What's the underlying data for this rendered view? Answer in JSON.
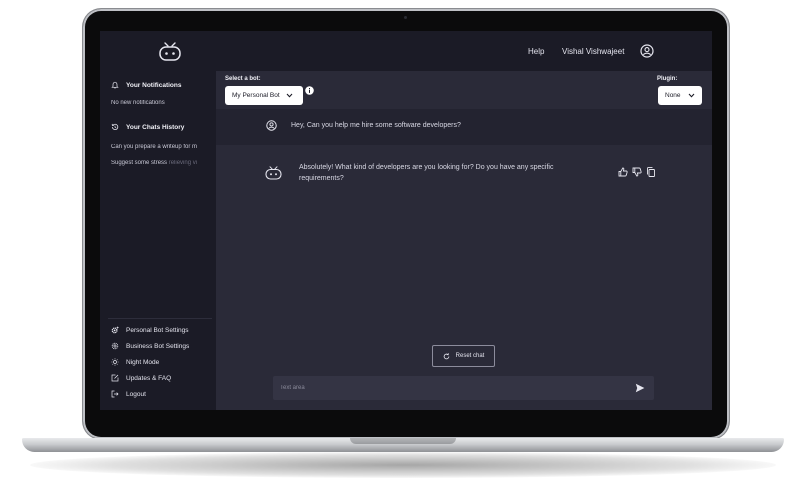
{
  "topbar": {
    "help_label": "Help",
    "user_name": "Vishal Vishwajeet",
    "logo_icon": "robot-logo-icon",
    "avatar_icon": "user-circle-icon"
  },
  "sidebar": {
    "notifications": {
      "title": "Your Notifications",
      "icon": "bell-icon",
      "empty_text": "No new notifications"
    },
    "history": {
      "title": "Your Chats History",
      "icon": "history-icon",
      "items": [
        {
          "visible": "Can you prepare a writeup for m",
          "faded": ""
        },
        {
          "visible": "Suggest some stress ",
          "faded": "relieving vi"
        }
      ]
    },
    "menu": [
      {
        "label": "Personal Bot Settings",
        "icon": "gear-plus-icon"
      },
      {
        "label": "Business Bot Settings",
        "icon": "gear-icon"
      },
      {
        "label": "Night Mode",
        "icon": "sun-icon"
      },
      {
        "label": "Updates & FAQ",
        "icon": "edit-icon"
      },
      {
        "label": "Logout",
        "icon": "logout-icon"
      }
    ]
  },
  "main": {
    "bot_select": {
      "label": "Select a bot:",
      "value": "My Personal Bot"
    },
    "plugin_select": {
      "label": "Plugin:",
      "value": "None"
    },
    "messages": [
      {
        "role": "user",
        "text": "Hey, Can you help me hire some software developers?"
      },
      {
        "role": "bot",
        "text": "Absolutely! What kind of developers are you looking for? Do you have any specific requirements?"
      }
    ],
    "reset_label": "Reset chat",
    "input": {
      "placeholder": "Text area",
      "value": ""
    }
  },
  "colors": {
    "screen_bg": "#1b1b26",
    "chat_bg": "#2a2a38",
    "user_msg_bg": "#232330",
    "input_bg": "#343444"
  }
}
